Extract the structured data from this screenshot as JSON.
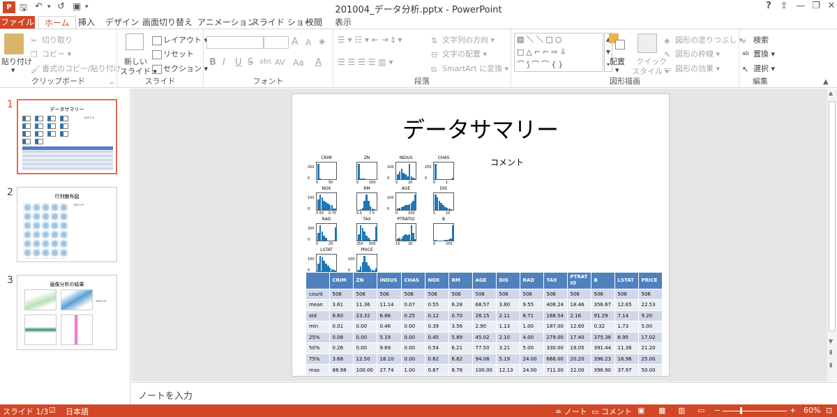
{
  "window": {
    "title": "201004_データ分析.pptx - PowerPoint",
    "app_icon": "P",
    "help": "?"
  },
  "tabs": [
    "ファイル",
    "ホーム",
    "挿入",
    "デザイン",
    "画面切り替え",
    "アニメーション",
    "スライド ショー",
    "校閲",
    "表示"
  ],
  "ribbon": {
    "clipboard": {
      "label": "クリップボード",
      "paste": "貼り付け",
      "cut": "切り取り",
      "copy": "コピー",
      "format_painter": "書式のコピー/貼り付け"
    },
    "slides": {
      "label": "スライド",
      "new_slide": "新しい",
      "new_slide2": "スライド",
      "layout": "レイアウト",
      "reset": "リセット",
      "section": "セクション"
    },
    "font": {
      "label": "フォント",
      "bold": "B",
      "italic": "I",
      "underline": "U",
      "strike": "S",
      "shadow": "abc",
      "spacing": "AV",
      "case": "Aa",
      "color": "A",
      "grow": "A",
      "shrink": "A"
    },
    "paragraph": {
      "label": "段落",
      "text_direction": "文字列の方向",
      "align_text": "文字の配置",
      "smartart": "SmartArt に変換"
    },
    "drawing": {
      "label": "図形描画",
      "arrange": "配置",
      "quick_styles": "クイック",
      "quick_styles2": "スタイル",
      "shape_fill": "図形の塗りつぶし",
      "shape_outline": "図形の枠線",
      "shape_effects": "図形の効果",
      "shape_glyphs": "▧＼＼□○\n□△⌐⌐⇨⇩\n⌒⟆⌒⌒{}"
    },
    "editing": {
      "label": "編集",
      "find": "検索",
      "replace": "置換",
      "select": "選択"
    }
  },
  "thumbnails": [
    {
      "num": "1",
      "title": "データサマリー",
      "comment": "コメント"
    },
    {
      "num": "2",
      "title": "行列散布図",
      "comment": "コメント"
    },
    {
      "num": "3",
      "title": "画像分析の結果",
      "comment": "コメント"
    }
  ],
  "slide": {
    "title": "データサマリー",
    "comment": "コメント",
    "histograms": [
      {
        "name": "CRIM",
        "yticks": [
          "250",
          "0"
        ],
        "xticks": [
          "0",
          "50"
        ],
        "bars": [
          1,
          0.03,
          0.01,
          0.01,
          0,
          0,
          0,
          0,
          0,
          0
        ]
      },
      {
        "name": "ZN",
        "yticks": [
          "",
          ""
        ],
        "xticks": [
          "0",
          "100"
        ],
        "bars": [
          1,
          0.05,
          0.04,
          0.03,
          0.02,
          0.02,
          0.01,
          0.01,
          0.01,
          0.02
        ]
      },
      {
        "name": "INDUS",
        "yticks": [
          "100",
          "0"
        ],
        "xticks": [
          "0",
          "20"
        ],
        "bars": [
          0.3,
          0.5,
          0.7,
          0.4,
          0.3,
          0.2,
          1,
          0.2,
          0.1,
          0.05
        ]
      },
      {
        "name": "CHAS",
        "yticks": [
          "250",
          "0"
        ],
        "xticks": [
          "0",
          "1"
        ],
        "bars": [
          1,
          0,
          0,
          0,
          0,
          0,
          0,
          0,
          0,
          0.08
        ]
      },
      {
        "name": "NOX",
        "yticks": [
          "100",
          "0"
        ],
        "xticks": [
          "0.50",
          "0.75"
        ],
        "bars": [
          0.7,
          1,
          0.8,
          0.6,
          0.5,
          0.4,
          0.3,
          0.3,
          0.1,
          0.1
        ]
      },
      {
        "name": "RM",
        "yticks": [
          "",
          ""
        ],
        "xticks": [
          "5.0",
          "7.5"
        ],
        "bars": [
          0.02,
          0.05,
          0.15,
          0.6,
          1,
          0.6,
          0.25,
          0.1,
          0.05,
          0.02
        ]
      },
      {
        "name": "AGE",
        "yticks": [
          "100",
          "0"
        ],
        "xticks": [
          "0",
          "100"
        ],
        "bars": [
          0.1,
          0.15,
          0.2,
          0.25,
          0.3,
          0.3,
          0.35,
          0.45,
          0.6,
          1
        ]
      },
      {
        "name": "DIS",
        "yticks": [
          "",
          ""
        ],
        "xticks": [
          "5",
          "10"
        ],
        "bars": [
          1,
          0.8,
          0.6,
          0.45,
          0.3,
          0.2,
          0.15,
          0.08,
          0.05,
          0.02
        ]
      },
      {
        "name": "RAD",
        "yticks": [
          "200",
          "0"
        ],
        "xticks": [
          "0",
          "20"
        ],
        "bars": [
          0.5,
          1,
          0.6,
          0.3,
          0.2,
          0,
          0,
          0,
          0,
          0.85
        ]
      },
      {
        "name": "TAX",
        "yticks": [
          "",
          ""
        ],
        "xticks": [
          "250",
          "500"
        ],
        "bars": [
          0.4,
          1,
          0.8,
          0.6,
          0.3,
          0.2,
          0.05,
          0,
          0.05,
          0.9
        ]
      },
      {
        "name": "PTRATIO",
        "yticks": [
          "",
          ""
        ],
        "xticks": [
          "15",
          "20"
        ],
        "bars": [
          0.15,
          0.2,
          0.15,
          0.3,
          0.4,
          0.35,
          0.4,
          1,
          0.5,
          0.1
        ]
      },
      {
        "name": "B",
        "yticks": [
          "",
          ""
        ],
        "xticks": [
          "0",
          "250"
        ],
        "bars": [
          0.03,
          0.01,
          0.01,
          0.02,
          0.02,
          0.03,
          0.05,
          0.08,
          0.15,
          1
        ]
      },
      {
        "name": "LSTAT",
        "yticks": [
          "100",
          "0"
        ],
        "xticks": [
          "0",
          "20"
        ],
        "bars": [
          0.5,
          1,
          0.9,
          0.7,
          0.5,
          0.35,
          0.25,
          0.15,
          0.08,
          0.04
        ]
      },
      {
        "name": "PRICE",
        "yticks": [
          "100",
          "0"
        ],
        "xticks": [
          "25",
          "50"
        ],
        "bars": [
          0.1,
          0.3,
          0.6,
          1,
          0.6,
          0.35,
          0.2,
          0.1,
          0.05,
          0.2
        ]
      }
    ],
    "table": {
      "headers": [
        "",
        "CRIM",
        "ZN",
        "INDUS",
        "CHAS",
        "NOX",
        "RM",
        "AGE",
        "DIS",
        "RAD",
        "TAX",
        "PTRAT IO",
        "B",
        "LSTAT",
        "PRICE"
      ],
      "rows": [
        [
          "count",
          "506",
          "506",
          "506",
          "506",
          "506",
          "506",
          "506",
          "506",
          "506",
          "506",
          "506",
          "506",
          "506",
          "506"
        ],
        [
          "mean",
          "3.61",
          "11.36",
          "11.14",
          "0.07",
          "0.55",
          "6.28",
          "68.57",
          "3.80",
          "9.55",
          "408.24",
          "18.46",
          "356.67",
          "12.65",
          "22.53"
        ],
        [
          "std",
          "8.60",
          "23.32",
          "6.86",
          "0.25",
          "0.12",
          "0.70",
          "28.15",
          "2.11",
          "8.71",
          "168.54",
          "2.16",
          "91.29",
          "7.14",
          "9.20"
        ],
        [
          "min",
          "0.01",
          "0.00",
          "0.46",
          "0.00",
          "0.39",
          "3.56",
          "2.90",
          "1.13",
          "1.00",
          "187.00",
          "12.60",
          "0.32",
          "1.73",
          "5.00"
        ],
        [
          "25%",
          "0.08",
          "0.00",
          "5.19",
          "0.00",
          "0.45",
          "5.89",
          "45.02",
          "2.10",
          "4.00",
          "279.00",
          "17.40",
          "375.38",
          "6.95",
          "17.02"
        ],
        [
          "50%",
          "0.26",
          "0.00",
          "9.69",
          "0.00",
          "0.54",
          "6.21",
          "77.50",
          "3.21",
          "5.00",
          "330.00",
          "19.05",
          "391.44",
          "11.36",
          "21.20"
        ],
        [
          "75%",
          "3.68",
          "12.50",
          "18.10",
          "0.00",
          "0.62",
          "6.62",
          "94.08",
          "5.19",
          "24.00",
          "666.00",
          "20.20",
          "396.23",
          "16.96",
          "25.00"
        ],
        [
          "max",
          "88.98",
          "100.00",
          "27.74",
          "1.00",
          "0.87",
          "8.78",
          "100.00",
          "12.13",
          "24.00",
          "711.00",
          "22.00",
          "396.90",
          "37.97",
          "50.00"
        ]
      ]
    }
  },
  "notes": {
    "placeholder": "ノートを入力"
  },
  "status": {
    "slide": "スライド 1/3",
    "language": "日本語",
    "notes": "ノート",
    "comments": "コメント",
    "zoom": "60%",
    "minus": "−",
    "plus": "+"
  }
}
